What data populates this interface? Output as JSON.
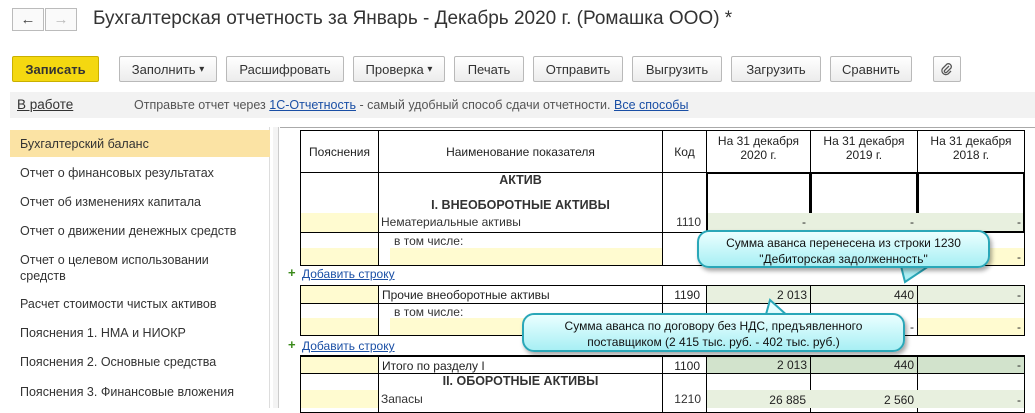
{
  "window": {
    "title": "Бухгалтерская отчетность за Январь - Декабрь 2020 г. (Ромашка ООО) *",
    "back_icon": "←",
    "forward_icon": "→"
  },
  "toolbar": {
    "save": "Записать",
    "fill": "Заполнить",
    "decode": "Расшифровать",
    "check": "Проверка",
    "print": "Печать",
    "send": "Отправить",
    "unload": "Выгрузить",
    "load": "Загрузить",
    "compare": "Сравнить",
    "dropdown_arrow": "▾",
    "attach_icon": "paperclip-icon"
  },
  "status": {
    "state": "В работе",
    "text_before": "Отправьте отчет через ",
    "link1": "1С-Отчетность",
    "text_after": " - самый удобный способ сдачи отчетности. ",
    "link2": "Все способы"
  },
  "sidebar": {
    "items": [
      {
        "label": "Бухгалтерский баланс",
        "active": true
      },
      {
        "label": "Отчет о финансовых результатах"
      },
      {
        "label": "Отчет об изменениях капитала"
      },
      {
        "label": "Отчет о движении денежных средств"
      },
      {
        "label": "Отчет о целевом использовании средств"
      },
      {
        "label": "Расчет стоимости чистых активов"
      },
      {
        "label": "Пояснения 1. НМА и НИОКР"
      },
      {
        "label": "Пояснения 2. Основные средства"
      },
      {
        "label": "Пояснения 3. Финансовые вложения"
      }
    ]
  },
  "table": {
    "headers": {
      "notes": "Пояснения",
      "name": "Наименование показателя",
      "code": "Код",
      "c2020": "На 31 декабря 2020 г.",
      "c2019": "На 31 декабря 2019 г.",
      "c2018": "На 31 декабря 2018 г."
    },
    "section_aktiv": "АКТИВ",
    "section1": "I. ВНЕОБОРОТНЫЕ АКТИВЫ",
    "section2": "II. ОБОРОТНЫЕ АКТИВЫ",
    "including": "в том числе:",
    "add_row": "Добавить строку",
    "add_icon": "+",
    "rows": [
      {
        "name": "Нематериальные активы",
        "code": "1110",
        "v2020": "-",
        "v2019": "-",
        "v2018": "-"
      },
      {
        "name": "",
        "code": "",
        "v2020": "",
        "v2019": "",
        "v2018": "-"
      },
      {
        "name": "Прочие внеоборотные активы",
        "code": "1190",
        "v2020": "2 013",
        "v2019": "440",
        "v2018": "-"
      },
      {
        "name": "",
        "code": "",
        "v2020": "",
        "v2019": "-",
        "v2018": "-"
      },
      {
        "name": "Итого по разделу I",
        "code": "1100",
        "v2020": "2 013",
        "v2019": "440",
        "v2018": "-"
      },
      {
        "name": "Запасы",
        "code": "1210",
        "v2020": "26 885",
        "v2019": "2 560",
        "v2018": "-"
      }
    ]
  },
  "callouts": {
    "first": "Сумма аванса перенесена из строки 1230 \"Дебиторская задолженность\"",
    "second": "Сумма аванса по договору без НДС, предъявленного поставщиком (2 415 тыс. руб. - 402 тыс. руб.)"
  }
}
